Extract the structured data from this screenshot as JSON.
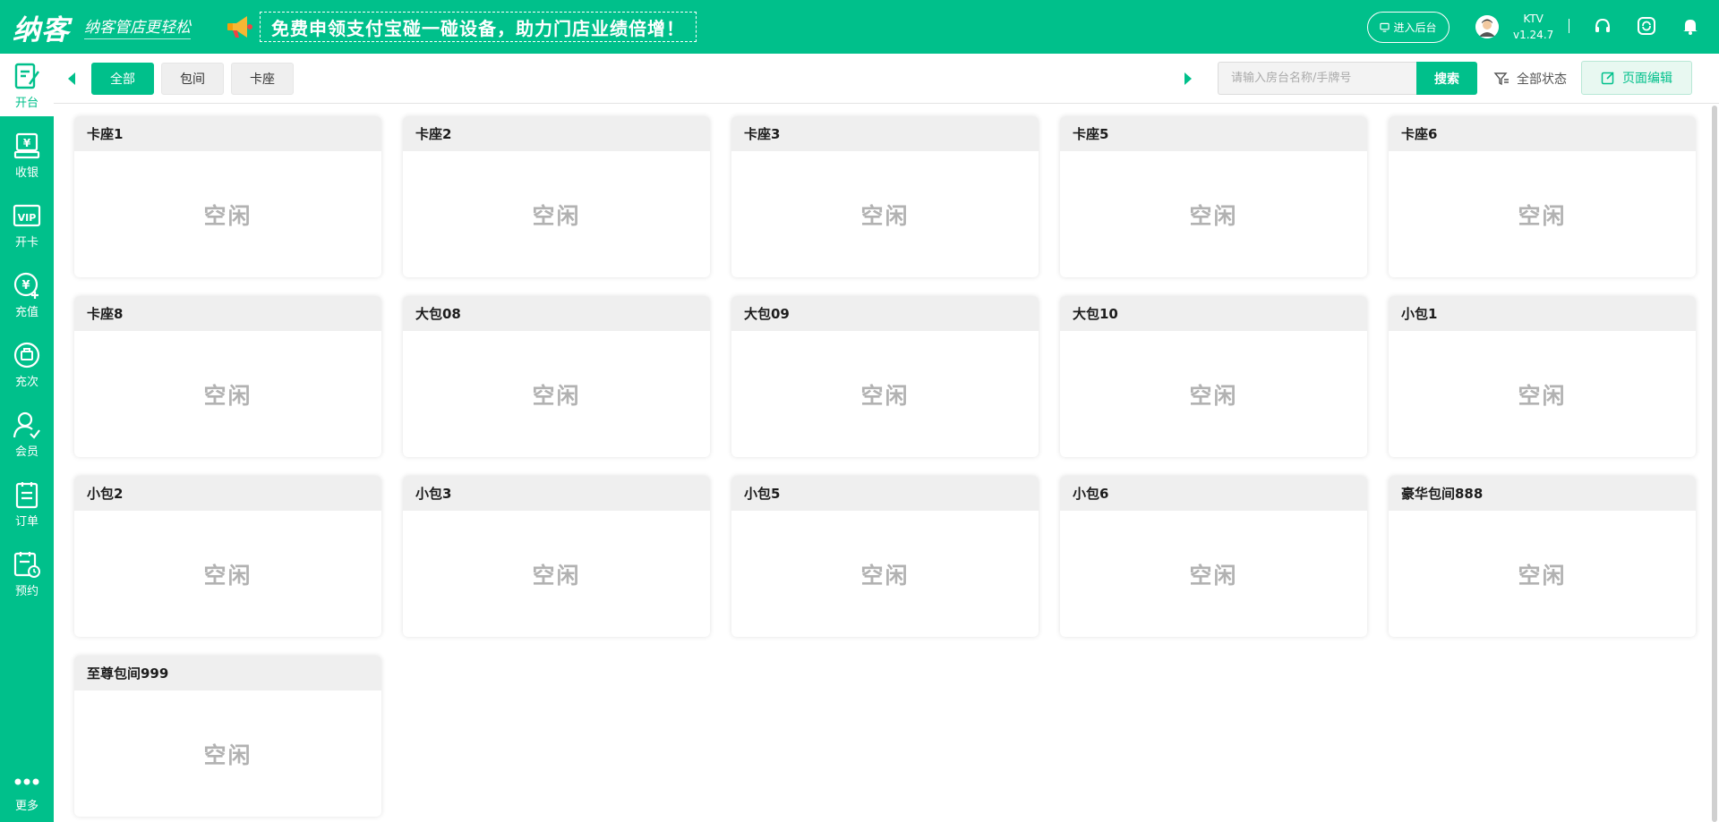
{
  "header": {
    "logo": "纳客",
    "slogan": "纳客管店更轻松",
    "promo": "免费申领支付宝碰一碰设备，助力门店业绩倍增！",
    "enter_admin": "进入后台",
    "user_name": "KTV",
    "version": "v1.24.7",
    "icons": [
      "headset-icon",
      "refresh-icon",
      "bell-icon"
    ]
  },
  "sidebar": {
    "items": [
      {
        "label": "开台",
        "icon": "open-table-icon"
      },
      {
        "label": "收银",
        "icon": "cashier-icon"
      },
      {
        "label": "开卡",
        "icon": "vip-card-icon"
      },
      {
        "label": "充值",
        "icon": "recharge-icon"
      },
      {
        "label": "充次",
        "icon": "recharge-times-icon"
      },
      {
        "label": "会员",
        "icon": "member-icon"
      },
      {
        "label": "订单",
        "icon": "order-icon"
      },
      {
        "label": "预约",
        "icon": "reservation-icon"
      }
    ],
    "more": "更多"
  },
  "toolbar": {
    "tabs": [
      "全部",
      "包间",
      "卡座"
    ],
    "search_placeholder": "请输入房台名称/手牌号",
    "search_label": "搜索",
    "filter_label": "全部状态",
    "page_edit_label": "页面编辑"
  },
  "rooms": [
    {
      "name": "卡座1",
      "status": "空闲"
    },
    {
      "name": "卡座2",
      "status": "空闲"
    },
    {
      "name": "卡座3",
      "status": "空闲"
    },
    {
      "name": "卡座5",
      "status": "空闲"
    },
    {
      "name": "卡座6",
      "status": "空闲"
    },
    {
      "name": "卡座8",
      "status": "空闲"
    },
    {
      "name": "大包08",
      "status": "空闲"
    },
    {
      "name": "大包09",
      "status": "空闲"
    },
    {
      "name": "大包10",
      "status": "空闲"
    },
    {
      "name": "小包1",
      "status": "空闲"
    },
    {
      "name": "小包2",
      "status": "空闲"
    },
    {
      "name": "小包3",
      "status": "空闲"
    },
    {
      "name": "小包5",
      "status": "空闲"
    },
    {
      "name": "小包6",
      "status": "空闲"
    },
    {
      "name": "豪华包间888",
      "status": "空闲"
    },
    {
      "name": "至尊包间999",
      "status": "空闲"
    }
  ],
  "colors": {
    "brand": "#00c08b",
    "idle_text": "#b2b2b2"
  }
}
